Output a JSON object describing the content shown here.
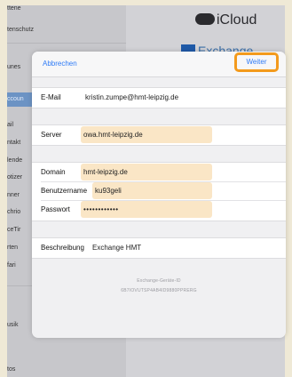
{
  "background": {
    "sidebar_items": [
      "ttene",
      "tenschutz",
      "unes",
      "ccoun",
      "ail",
      "ntakt",
      "lende",
      "otizer",
      "nner",
      "chrio",
      "ceTir",
      "rten",
      "fari",
      "usik",
      "tos"
    ],
    "icloud_label": "iCloud",
    "exchange_label": "Exchange"
  },
  "modal": {
    "cancel_label": "Abbrechen",
    "next_label": "Weiter",
    "email": {
      "label": "E-Mail",
      "value": "kristin.zumpe@hmt-leipzig.de"
    },
    "server": {
      "label": "Server",
      "value": "owa.hmt-leipzig.de"
    },
    "domain": {
      "label": "Domain",
      "value": "hmt-leipzig.de"
    },
    "username": {
      "label": "Benutzername",
      "value": "ku93geli"
    },
    "password": {
      "label": "Passwort",
      "value": "••••••••••••"
    },
    "description": {
      "label": "Beschreibung",
      "value": "Exchange HMT"
    },
    "device_id_title": "Exchange-Geräte-ID",
    "device_id": "6B7IOVUTSP4AB4ID9880PPRERG"
  },
  "colors": {
    "accent": "#2f7bf6",
    "highlight_border": "#f39a1c",
    "field_highlight": "#fae6c6"
  }
}
